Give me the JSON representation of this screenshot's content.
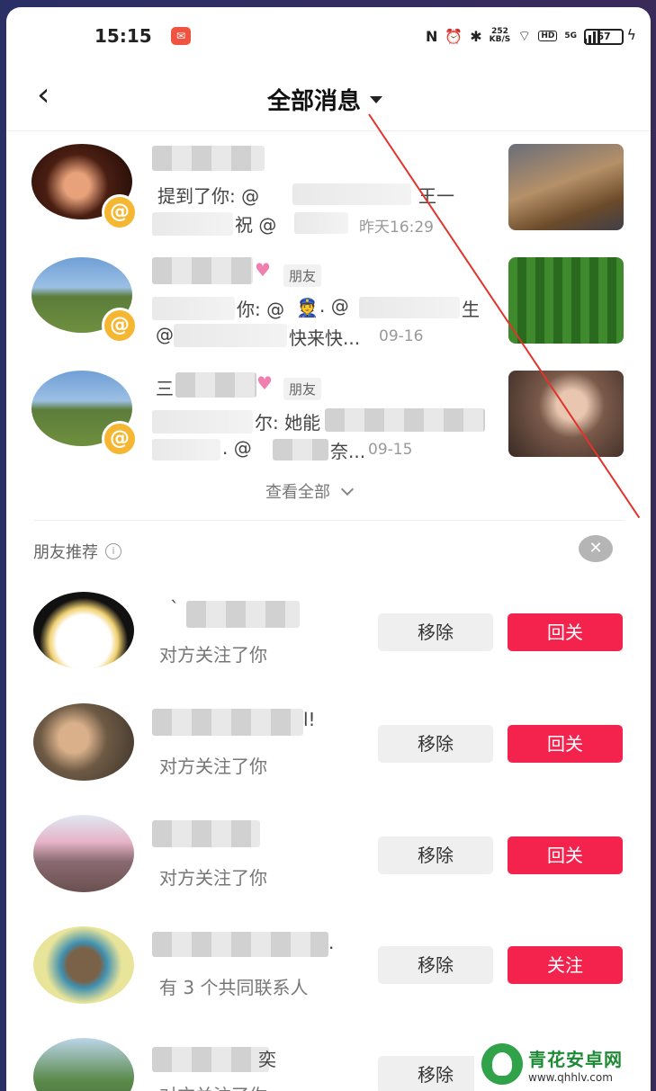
{
  "status_bar": {
    "time": "15:15",
    "app_badge_icon": "app-notification-icon",
    "nfc": "N",
    "speed_value": "252",
    "speed_unit": "KB/S",
    "hd": "HD",
    "network": "5G",
    "battery": "67"
  },
  "header": {
    "title": "全部消息"
  },
  "messages": [
    {
      "line1_prefix": "提到了你: @",
      "line1_suffix": "王一",
      "line2_mid": "祝 @",
      "time": "昨天16:29"
    },
    {
      "tag": "朋友",
      "line1_prefix": "你: @",
      "line1_mid": ". @",
      "line1_suffix": "生",
      "line2_prefix": "@",
      "line2_mid": "快来快...",
      "time": "09-16"
    },
    {
      "name_prefix": "三",
      "tag": "朋友",
      "line1_prefix": "尔: 她能",
      "line2_mid": ". @",
      "line2_suffix": "奈...",
      "time": "09-15"
    }
  ],
  "view_all": "查看全部",
  "recommend": {
    "label": "朋友推荐",
    "items": [
      {
        "name_prefix": "`",
        "sub": "对方关注了你",
        "remove": "移除",
        "action": "回关"
      },
      {
        "name_suffix": "l!",
        "sub": "对方关注了你",
        "remove": "移除",
        "action": "回关"
      },
      {
        "sub": "对方关注了你",
        "remove": "移除",
        "action": "回关"
      },
      {
        "name_suffix": ".",
        "sub": "有 3 个共同联系人",
        "remove": "移除",
        "action": "关注"
      },
      {
        "name_suffix": "奕",
        "sub": "对方关注了你",
        "remove": "移除"
      }
    ]
  },
  "watermark": {
    "name": "青花安卓网",
    "url": "www.qhhlv.com"
  },
  "colors": {
    "follow_red": "#f4234e",
    "at_badge": "#f5b731",
    "annotation_line": "#e0342c"
  }
}
